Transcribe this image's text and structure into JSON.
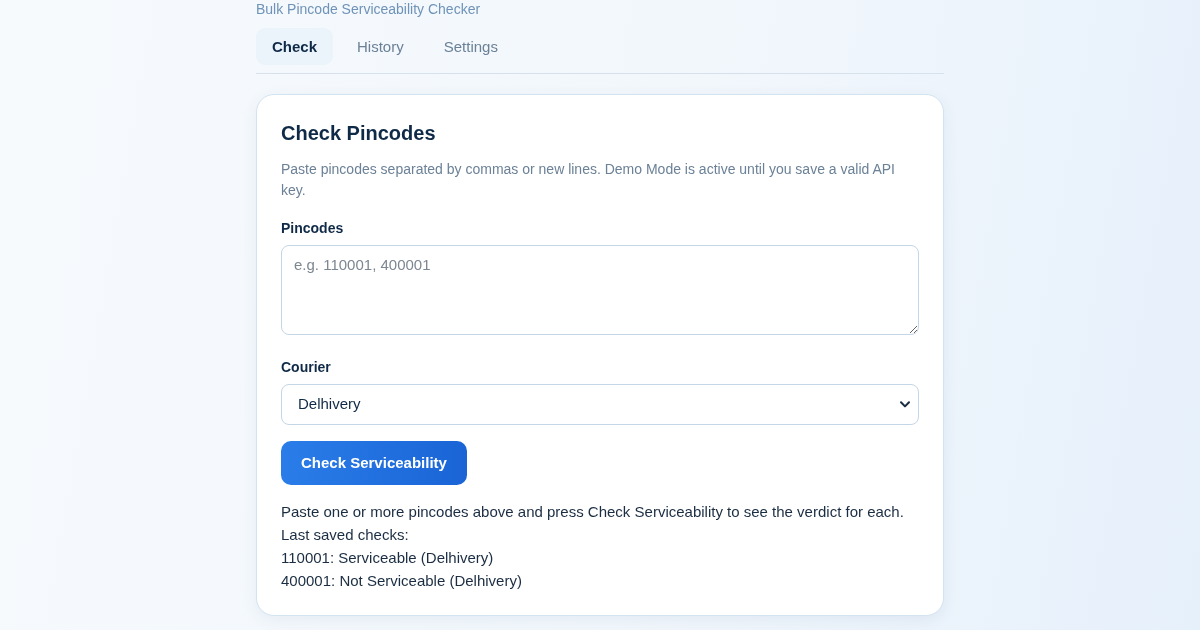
{
  "subtitle": "Bulk Pincode Serviceability Checker",
  "tabs": [
    {
      "label": "Check",
      "selected": true
    },
    {
      "label": "History",
      "selected": false
    },
    {
      "label": "Settings",
      "selected": false
    }
  ],
  "card": {
    "title": "Check Pincodes",
    "description": "Paste pincodes separated by commas or new lines. Demo Mode is active until you save a valid API key.",
    "pincodes": {
      "label": "Pincodes",
      "placeholder": "e.g. 110001, 400001"
    },
    "courier": {
      "label": "Courier",
      "value": "Delhivery"
    },
    "button": "Check Serviceability",
    "result": {
      "message": "Paste one or more pincodes above and press Check Serviceability to see the verdict for each.",
      "saved_heading": "Last saved checks:",
      "saved_checks": [
        "110001: Serviceable (Delhivery)",
        "400001: Not Serviceable (Delhivery)"
      ]
    }
  }
}
